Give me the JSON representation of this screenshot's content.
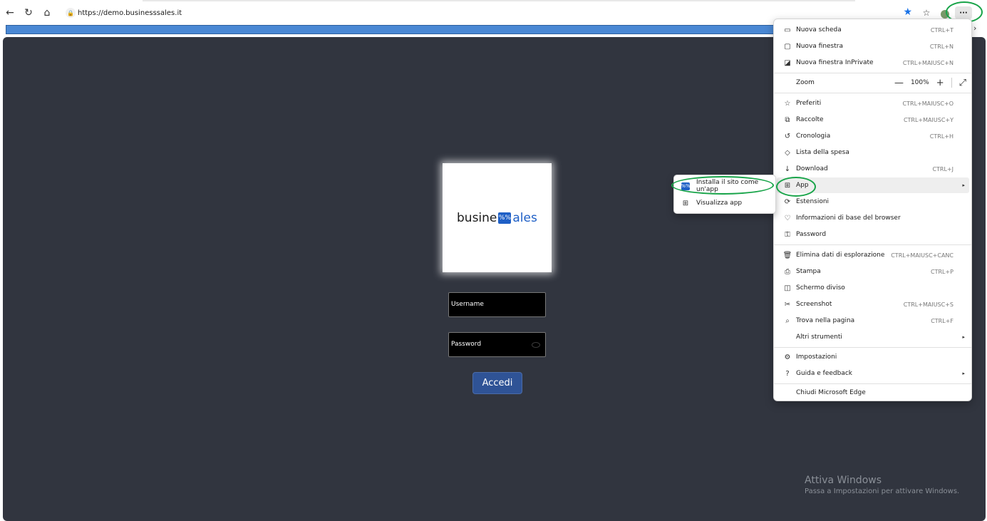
{
  "browser": {
    "url": "https://demo.businesssales.it",
    "nav_icons": [
      "back-arrow-icon",
      "refresh-icon",
      "home-icon"
    ],
    "more_button_label": "···"
  },
  "page": {
    "logo": {
      "left": "busine",
      "mid": "%%",
      "right": "ales"
    },
    "username_placeholder": "Username",
    "password_placeholder": "Password",
    "login_button": "Accedi",
    "watermark_title": "Attiva Windows",
    "watermark_subtitle": "Passa a Impostazioni per attivare Windows."
  },
  "menu": {
    "items": [
      {
        "icon": "▭",
        "label": "Nuova scheda",
        "shortcut": "CTRL+T"
      },
      {
        "icon": "▢",
        "label": "Nuova finestra",
        "shortcut": "CTRL+N"
      },
      {
        "icon": "◪",
        "label": "Nuova finestra InPrivate",
        "shortcut": "CTRL+MAIUSC+N"
      },
      {
        "icon": "",
        "label": "Zoom",
        "shortcut": ""
      },
      {
        "icon": "☆",
        "label": "Preferiti",
        "shortcut": "CTRL+MAIUSC+O"
      },
      {
        "icon": "⧉",
        "label": "Raccolte",
        "shortcut": "CTRL+MAIUSC+Y"
      },
      {
        "icon": "↺",
        "label": "Cronologia",
        "shortcut": "CTRL+H"
      },
      {
        "icon": "◇",
        "label": "Lista della spesa",
        "shortcut": ""
      },
      {
        "icon": "↓",
        "label": "Download",
        "shortcut": "CTRL+J"
      },
      {
        "icon": "⊞",
        "label": "App",
        "shortcut": "",
        "arrow": "▸"
      },
      {
        "icon": "⟳",
        "label": "Estensioni",
        "shortcut": ""
      },
      {
        "icon": "♡",
        "label": "Informazioni di base del browser",
        "shortcut": ""
      },
      {
        "icon": "⚿",
        "label": "Password",
        "shortcut": ""
      },
      {
        "icon": "🗑",
        "label": "Elimina dati di esplorazione",
        "shortcut": "CTRL+MAIUSC+CANC"
      },
      {
        "icon": "⎙",
        "label": "Stampa",
        "shortcut": "CTRL+P"
      },
      {
        "icon": "◫",
        "label": "Schermo diviso",
        "shortcut": ""
      },
      {
        "icon": "✂",
        "label": "Screenshot",
        "shortcut": "CTRL+MAIUSC+S"
      },
      {
        "icon": "⌕",
        "label": "Trova nella pagina",
        "shortcut": "CTRL+F"
      },
      {
        "icon": "",
        "label": "Altri strumenti",
        "shortcut": "",
        "arrow": "▸"
      },
      {
        "icon": "⚙",
        "label": "Impostazioni",
        "shortcut": ""
      },
      {
        "icon": "?",
        "label": "Guida e feedback",
        "shortcut": "",
        "arrow": "▸"
      },
      {
        "icon": "",
        "label": "Chiudi Microsoft Edge",
        "shortcut": ""
      }
    ],
    "zoom": {
      "minus": "—",
      "value": "100%",
      "plus": "+",
      "fullscreen": "⤢"
    }
  },
  "submenu": {
    "items": [
      {
        "icon": "%%",
        "label": "Installa il sito come un'app"
      },
      {
        "icon": "⊞",
        "label": "Visualizza app"
      }
    ]
  },
  "colors": {
    "page_bg": "#31353f",
    "progress_bar": "#4a88d4",
    "login_button": "#2f5396",
    "highlight_ring": "#18a449",
    "brand_blue": "#1e5fc6"
  }
}
